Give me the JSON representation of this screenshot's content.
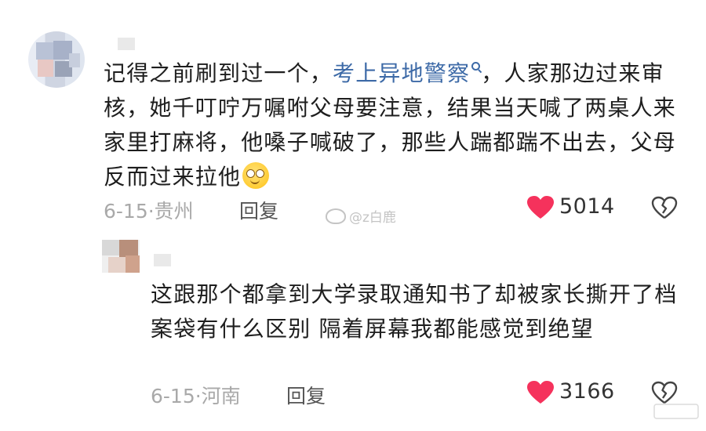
{
  "comments": [
    {
      "text_before_link": "记得之前刷到过一个，",
      "link_text": "考上异地警察",
      "text_after_link": "，人家那边过来审核，她千叮咛万嘱咐父母要注意，结果当天喊了两桌人来家里打麻将，他嗓子喊破了，那些人踹都踹不出去，父母反而过来拉他",
      "emoji": "smiling-face-icon",
      "date_location": "6-15·贵州",
      "reply_label": "回复",
      "likes": "5014"
    },
    {
      "text": "这跟那个都拿到大学录取通知书了却被家长撕开了档案袋有什么区别 隔着屏幕我都能感觉到绝望",
      "date_location": "6-15·河南",
      "reply_label": "回复",
      "likes": "3166"
    }
  ],
  "watermark": "@z白鹿",
  "colors": {
    "heart": "#f5325c",
    "link": "#3d6aa7",
    "meta": "#a9a9a9"
  }
}
